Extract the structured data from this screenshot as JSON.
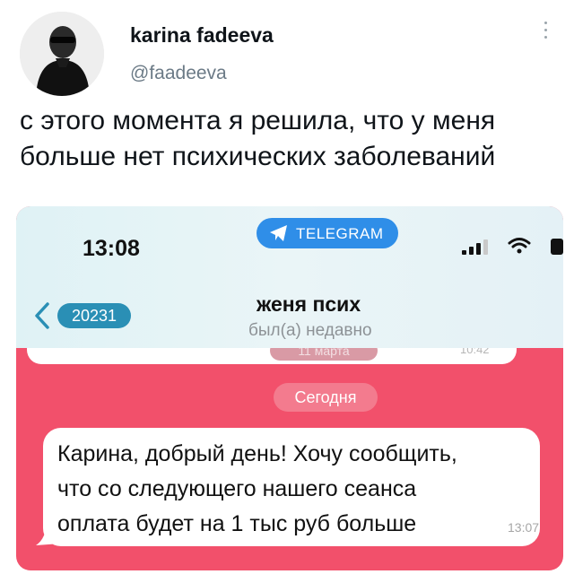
{
  "tweet": {
    "author_name": "karina fadeeva",
    "author_handle": "@faadeeva",
    "text_line1": "с этого момента я решила, что у меня",
    "text_line2": "больше нет психических заболеваний"
  },
  "screenshot": {
    "status_bar": {
      "time": "13:08",
      "app_pill": "TELEGRAM"
    },
    "chat_header": {
      "back_badge": "20231",
      "name": "женя псих",
      "status": "был(а) недавно"
    },
    "previous": {
      "date_pill": "11 марта",
      "time": "10:42"
    },
    "today_label": "Сегодня",
    "message": {
      "line1": "Карина, добрый день! Хочу сообщить,",
      "line2": "что со следующего нашего сеанса",
      "line3": "оплата будет на 1 тыс руб больше",
      "time": "13:07"
    }
  },
  "icons": [
    "more-vertical-icon",
    "telegram-plane-icon",
    "signal-icon",
    "wifi-icon",
    "battery-icon",
    "back-chevron-icon"
  ],
  "colors": {
    "chat_background": "#f2506b",
    "telegram_blue": "#2f8ee8",
    "today_pill": "#f37b8e",
    "back_badge": "#2a8fb5"
  }
}
